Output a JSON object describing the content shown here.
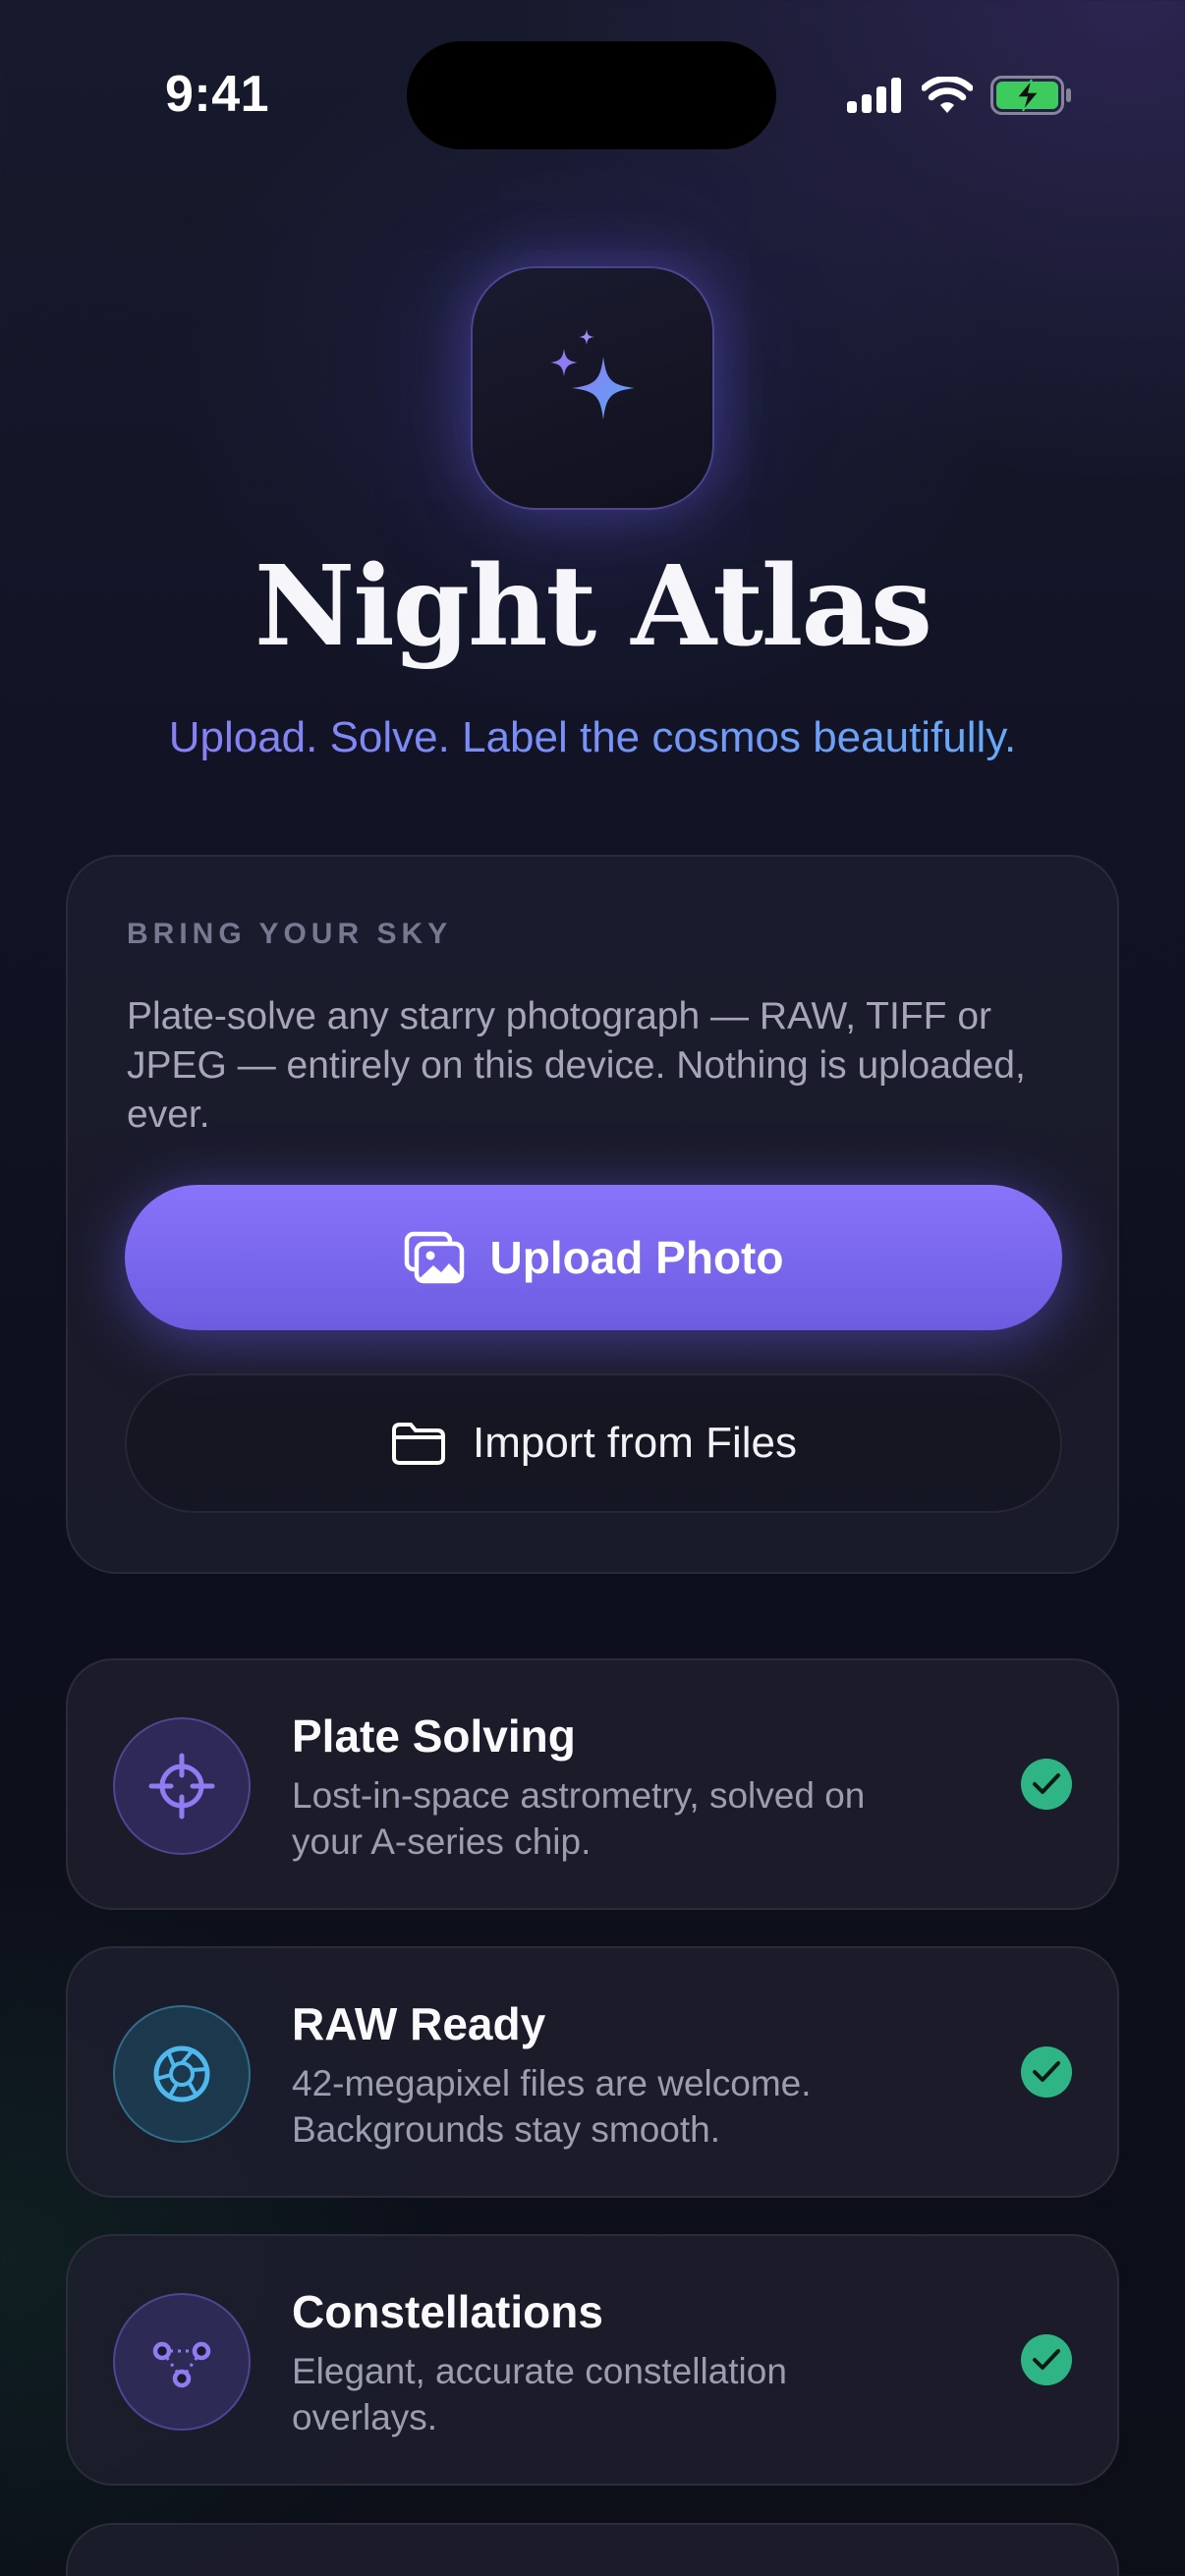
{
  "status_bar": {
    "time": "9:41"
  },
  "app": {
    "title": "Night Atlas",
    "tagline": "Upload. Solve. Label the cosmos beautifully.",
    "icon": "sparkles-icon"
  },
  "upload_card": {
    "eyebrow": "BRING YOUR SKY",
    "description": "Plate-solve any starry photograph — RAW, TIFF or JPEG — entirely on this device. Nothing is uploaded, ever.",
    "upload_button": {
      "label": "Upload Photo",
      "icon": "photos-icon"
    },
    "import_button": {
      "label": "Import from Files",
      "icon": "folder-icon"
    }
  },
  "features": [
    {
      "title": "Plate Solving",
      "description": "Lost-in-space astrometry, solved on your A-series chip.",
      "icon": "crosshair-icon",
      "status": "checked"
    },
    {
      "title": "RAW Ready",
      "description": "42-megapixel files are welcome. Backgrounds stay smooth.",
      "icon": "aperture-icon",
      "status": "checked"
    },
    {
      "title": "Constellations",
      "description": "Elegant, accurate constellation overlays.",
      "icon": "constellation-icon",
      "status": "checked"
    }
  ],
  "colors": {
    "accent": "#7c6bf2",
    "check": "#2fb585",
    "tagline_start": "#8d79f2",
    "tagline_end": "#5fb4f5"
  }
}
